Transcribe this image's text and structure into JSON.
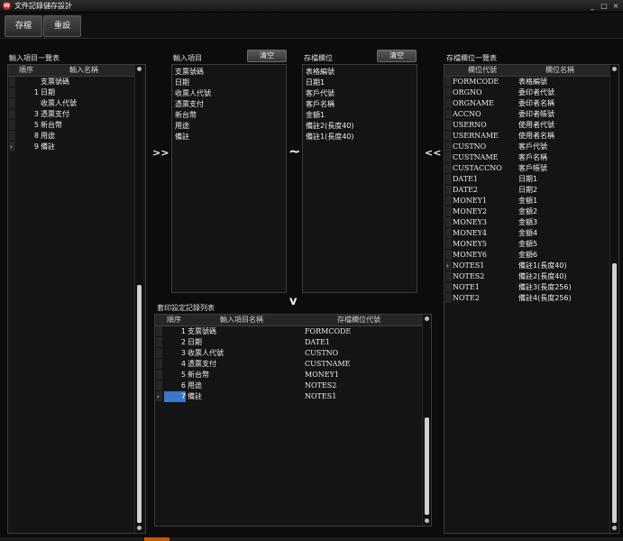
{
  "window": {
    "title": "文件記錄儲存設計"
  },
  "toolbar": {
    "save": "存檔",
    "reset": "重設"
  },
  "input_items": {
    "label": "輸入項目一覽表",
    "col_seq": "順序",
    "col_name": "輸入名稱",
    "rows": [
      {
        "seq": "",
        "name": "支票號碼"
      },
      {
        "seq": "1",
        "name": "日期"
      },
      {
        "seq": "",
        "name": "收票人代號"
      },
      {
        "seq": "3",
        "name": "憑票支付"
      },
      {
        "seq": "5",
        "name": "新台幣"
      },
      {
        "seq": "8",
        "name": "用途"
      },
      {
        "seq": "9",
        "name": "備註"
      }
    ]
  },
  "input_fields": {
    "label": "輸入項目",
    "clear": "清空",
    "items": [
      "支票號碼",
      "日期",
      "收票人代號",
      "憑票支付",
      "新台幣",
      "用途",
      "備註"
    ]
  },
  "storage_fields": {
    "label": "存檔欄位",
    "clear": "清空",
    "items": [
      "表格編號",
      "日期1",
      "客戶代號",
      "客戶名稱",
      "金額1",
      "備註2(長度40)",
      "備註1(長度40)"
    ]
  },
  "storage_list": {
    "label": "存檔欄位一覽表",
    "col_code": "欄位代號",
    "col_name": "欄位名稱",
    "rows": [
      {
        "code": "FORMCODE",
        "name": "表格編號"
      },
      {
        "code": "ORGNO",
        "name": "委印者代號"
      },
      {
        "code": "ORGNAME",
        "name": "委印者名稱"
      },
      {
        "code": "ACCNO",
        "name": "委印者帳號"
      },
      {
        "code": "USERNO",
        "name": "使用者代號"
      },
      {
        "code": "USERNAME",
        "name": "使用者名稱"
      },
      {
        "code": "CUSTNO",
        "name": "客戶代號"
      },
      {
        "code": "CUSTNAME",
        "name": "客戶名稱"
      },
      {
        "code": "CUSTACCNO",
        "name": "客戶帳號"
      },
      {
        "code": "DATE1",
        "name": "日期1"
      },
      {
        "code": "DATE2",
        "name": "日期2"
      },
      {
        "code": "MONEY1",
        "name": "金額1"
      },
      {
        "code": "MONEY2",
        "name": "金額2"
      },
      {
        "code": "MONEY3",
        "name": "金額3"
      },
      {
        "code": "MONEY4",
        "name": "金額4"
      },
      {
        "code": "MONEY5",
        "name": "金額5"
      },
      {
        "code": "MONEY6",
        "name": "金額6"
      },
      {
        "code": "NOTES1",
        "name": "備註1(長度40)"
      },
      {
        "code": "NOTES2",
        "name": "備註2(長度40)"
      },
      {
        "code": "NOTE1",
        "name": "備註3(長度256)"
      },
      {
        "code": "NOTE2",
        "name": "備註4(長度256)"
      }
    ]
  },
  "mapping": {
    "label": "套印設定記錄列表",
    "col_seq": "順序",
    "col_input": "輸入項目名稱",
    "col_field": "存檔欄位代號",
    "rows": [
      {
        "seq": "1",
        "input": "支票號碼",
        "field": "FORMCODE"
      },
      {
        "seq": "2",
        "input": "日期",
        "field": "DATE1"
      },
      {
        "seq": "3",
        "input": "收票人代號",
        "field": "CUSTNO"
      },
      {
        "seq": "4",
        "input": "憑票支付",
        "field": "CUSTNAME"
      },
      {
        "seq": "5",
        "input": "新台幣",
        "field": "MONEY1"
      },
      {
        "seq": "6",
        "input": "用途",
        "field": "NOTES2"
      },
      {
        "seq": "7",
        "input": "備註",
        "field": "NOTES1"
      }
    ]
  },
  "controls": {
    "add": ">>",
    "link": "~",
    "down": "v",
    "remove": "<<"
  }
}
